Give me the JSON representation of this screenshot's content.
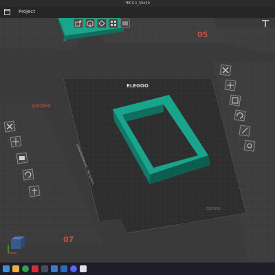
{
  "window": {
    "title": "*ECX-1_50x30"
  },
  "menubar": {
    "project_label": "Project"
  },
  "viewport": {
    "plates": [
      {
        "number": "05"
      },
      {
        "number": "07"
      }
    ],
    "current_plate_name": "Untitled",
    "printer_brand": "ELEGOO",
    "plate_text": "256x256x256mm² - PEI Surface",
    "plate_footer_brand": "ELEGOO"
  },
  "colors": {
    "model": "#18a58c",
    "model_shade": "#0f6e5e",
    "plate_number": "#c9533a"
  },
  "toolbar": {
    "icons": [
      "add-object-icon",
      "cube-icon",
      "orient-icon",
      "arrange-icon",
      "slice-icon",
      "text-tool-icon"
    ]
  },
  "left_tools": {
    "icons": [
      "remove-icon",
      "move-icon",
      "fill-icon",
      "rotate-icon",
      "support-icon"
    ]
  },
  "right_tools": {
    "icons": [
      "remove-icon",
      "move-icon",
      "scale-icon",
      "rotate-icon",
      "cut-icon",
      "settings-icon"
    ]
  },
  "taskbar": {
    "icons": [
      "start-icon",
      "files-icon",
      "chrome-icon",
      "pdf-icon",
      "app-icon",
      "photos-icon",
      "mail-icon",
      "discord-icon",
      "slicer-icon"
    ]
  }
}
